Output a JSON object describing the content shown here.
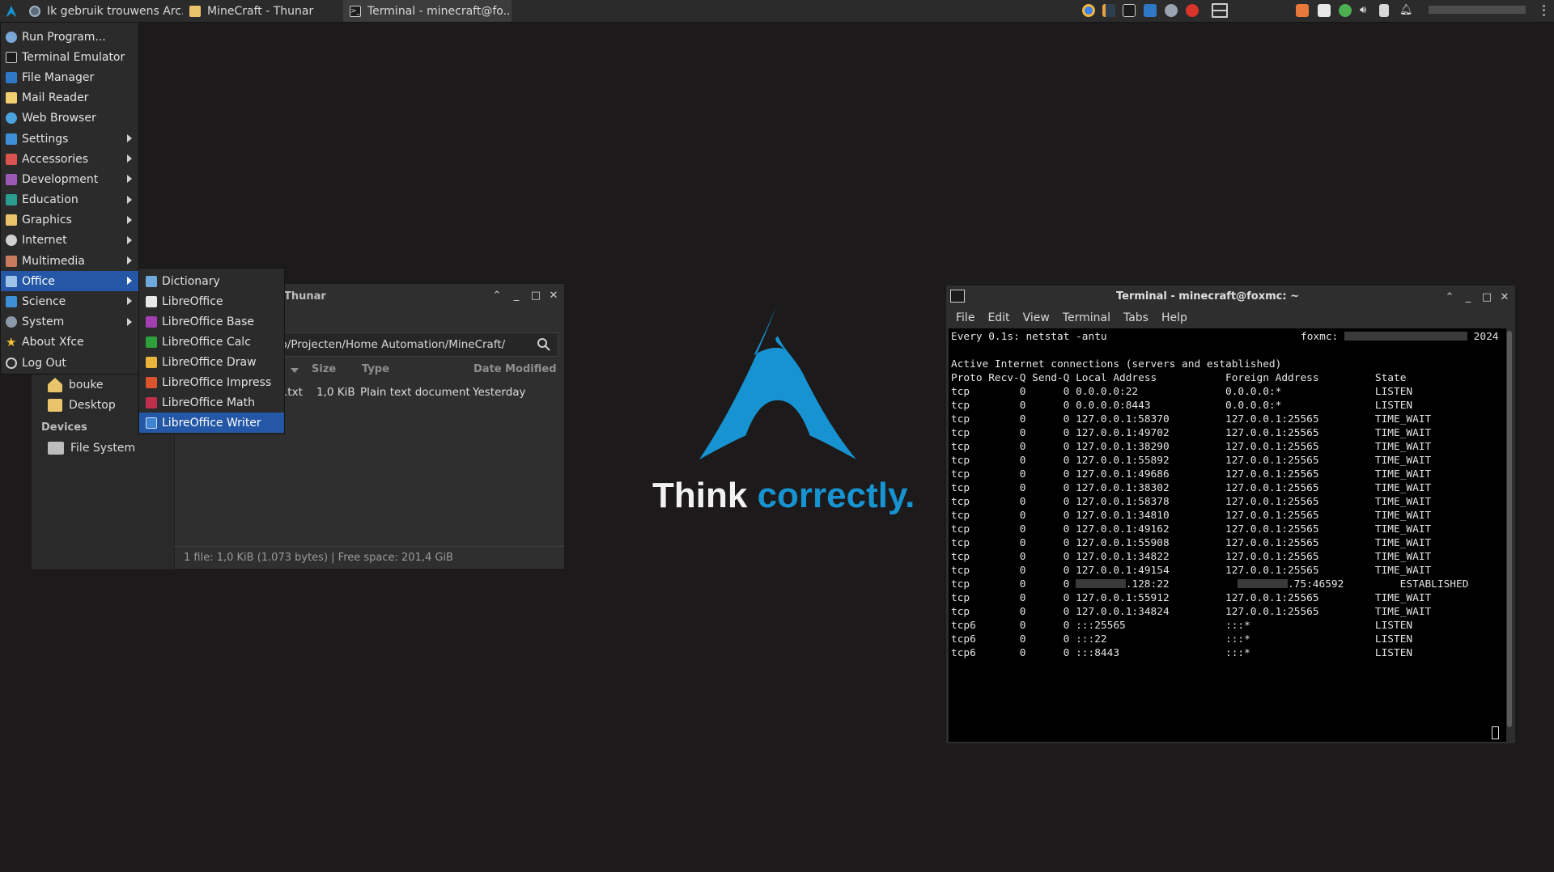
{
  "taskbar": {
    "windows": [
      {
        "title": "Ik gebruik trouwens Arc...",
        "icon": "web-browser-icon"
      },
      {
        "title": "MineCraft - Thunar",
        "icon": "folder-icon"
      },
      {
        "title": "Terminal - minecraft@fo...",
        "icon": "terminal-icon"
      }
    ]
  },
  "app_menu": {
    "items": [
      {
        "label": "Run Program...",
        "icon": "run-program-icon",
        "submenu": false
      },
      {
        "label": "Terminal Emulator",
        "icon": "terminal-icon",
        "submenu": false
      },
      {
        "label": "File Manager",
        "icon": "file-manager-icon",
        "submenu": false
      },
      {
        "label": "Mail Reader",
        "icon": "mail-icon",
        "submenu": false
      },
      {
        "label": "Web Browser",
        "icon": "web-browser-icon",
        "submenu": false
      },
      {
        "label": "Settings",
        "icon": "settings-icon",
        "submenu": true
      },
      {
        "label": "Accessories",
        "icon": "accessories-icon",
        "submenu": true
      },
      {
        "label": "Development",
        "icon": "development-icon",
        "submenu": true
      },
      {
        "label": "Education",
        "icon": "education-icon",
        "submenu": true
      },
      {
        "label": "Graphics",
        "icon": "graphics-icon",
        "submenu": true
      },
      {
        "label": "Internet",
        "icon": "internet-icon",
        "submenu": true
      },
      {
        "label": "Multimedia",
        "icon": "multimedia-icon",
        "submenu": true
      },
      {
        "label": "Office",
        "icon": "office-icon",
        "submenu": true,
        "selected": true
      },
      {
        "label": "Science",
        "icon": "science-icon",
        "submenu": true
      },
      {
        "label": "System",
        "icon": "system-icon",
        "submenu": true
      },
      {
        "label": "About Xfce",
        "icon": "star-icon",
        "submenu": false
      },
      {
        "label": "Log Out",
        "icon": "logout-icon",
        "submenu": false
      }
    ],
    "office_submenu": [
      {
        "label": "Dictionary",
        "icon": "dictionary-icon"
      },
      {
        "label": "LibreOffice",
        "icon": "libreoffice-icon"
      },
      {
        "label": "LibreOffice Base",
        "icon": "libreoffice-base-icon"
      },
      {
        "label": "LibreOffice Calc",
        "icon": "libreoffice-calc-icon"
      },
      {
        "label": "LibreOffice Draw",
        "icon": "libreoffice-draw-icon"
      },
      {
        "label": "LibreOffice Impress",
        "icon": "libreoffice-impress-icon"
      },
      {
        "label": "LibreOffice Math",
        "icon": "libreoffice-math-icon"
      },
      {
        "label": "LibreOffice Writer",
        "icon": "libreoffice-writer-icon",
        "selected": true
      }
    ]
  },
  "thunar": {
    "title": "Thunar",
    "path": "op/Projecten/Home Automation/MineCraft/",
    "sidebar": {
      "places": [
        {
          "label": "bouke",
          "icon": "home-folder-icon"
        },
        {
          "label": "Desktop",
          "icon": "desktop-folder-icon"
        }
      ],
      "devices_heading": "Devices",
      "devices": [
        {
          "label": "File System",
          "icon": "drive-icon"
        }
      ]
    },
    "columns": {
      "size": "Size",
      "type": "Type",
      "modified": "Date Modified"
    },
    "file": {
      "name": ".txt",
      "size": "1,0 KiB",
      "type": "Plain text document",
      "modified": "Yesterday"
    },
    "status": "1 file: 1,0 KiB (1.073 bytes)  |  Free space: 201,4 GiB"
  },
  "wallpaper": {
    "tagline_plain": "Think",
    "tagline_accent": "correctly."
  },
  "terminal": {
    "title": "Terminal - minecraft@foxmc: ~",
    "menu": [
      "File",
      "Edit",
      "View",
      "Terminal",
      "Tabs",
      "Help"
    ],
    "watch_header": "Every 0.1s: netstat -antu",
    "host_label": "foxmc:",
    "year": "2024",
    "intro": "Active Internet connections (servers and established)",
    "header": "Proto Recv-Q Send-Q Local Address           Foreign Address         State",
    "rows": [
      "tcp        0      0 0.0.0.0:22              0.0.0.0:*               LISTEN",
      "tcp        0      0 0.0.0.0:8443            0.0.0.0:*               LISTEN",
      "tcp        0      0 127.0.0.1:58370         127.0.0.1:25565         TIME_WAIT",
      "tcp        0      0 127.0.0.1:49702         127.0.0.1:25565         TIME_WAIT",
      "tcp        0      0 127.0.0.1:38290         127.0.0.1:25565         TIME_WAIT",
      "tcp        0      0 127.0.0.1:55892         127.0.0.1:25565         TIME_WAIT",
      "tcp        0      0 127.0.0.1:49686         127.0.0.1:25565         TIME_WAIT",
      "tcp        0      0 127.0.0.1:38302         127.0.0.1:25565         TIME_WAIT",
      "tcp        0      0 127.0.0.1:58378         127.0.0.1:25565         TIME_WAIT",
      "tcp        0      0 127.0.0.1:34810         127.0.0.1:25565         TIME_WAIT",
      "tcp        0      0 127.0.0.1:49162         127.0.0.1:25565         TIME_WAIT",
      "tcp        0      0 127.0.0.1:55908         127.0.0.1:25565         TIME_WAIT",
      "tcp        0      0 127.0.0.1:34822         127.0.0.1:25565         TIME_WAIT",
      "tcp        0      0 127.0.0.1:49154         127.0.0.1:25565         TIME_WAIT",
      "tcp        0      0 [R8].128:22           [R8].75:46592         ESTABLISHED",
      "tcp        0      0 127.0.0.1:55912         127.0.0.1:25565         TIME_WAIT",
      "tcp        0      0 127.0.0.1:34824         127.0.0.1:25565         TIME_WAIT",
      "tcp6       0      0 :::25565                :::*                    LISTEN",
      "tcp6       0      0 :::22                   :::*                    LISTEN",
      "tcp6       0      0 :::8443                 :::*                    LISTEN"
    ]
  },
  "colors": {
    "accent_blue": "#1793d1",
    "menu_selection": "#2458a6",
    "panel": "#2b2b2b",
    "desktop": "#1c1a1b"
  }
}
